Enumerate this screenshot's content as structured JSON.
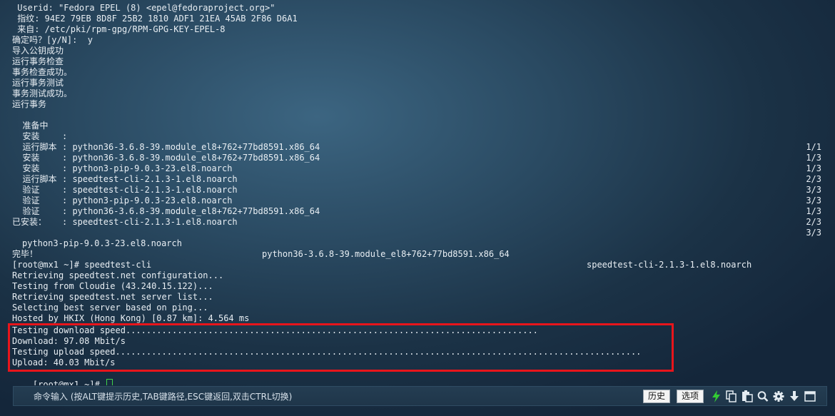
{
  "terminal": {
    "header_lines": [
      " Userid: \"Fedora EPEL (8) <epel@fedoraproject.org>\"",
      " 指纹: 94E2 79EB 8D8F 25B2 1810 ADF1 21EA 45AB 2F86 D6A1",
      " 来自: /etc/pki/rpm-gpg/RPM-GPG-KEY-EPEL-8",
      "确定吗？[y/N]:  y",
      "导入公钥成功",
      "运行事务检查",
      "事务检查成功。",
      "运行事务测试",
      "事务测试成功。",
      "运行事务"
    ],
    "transactions": [
      {
        "action": "  准备中  ",
        "package": ":",
        "progress": "1/1"
      },
      {
        "action": "  安装    ",
        "package": ": python36-3.6.8-39.module_el8+762+77bd8591.x86_64",
        "progress": "1/3"
      },
      {
        "action": "  运行脚本",
        "package": ": python36-3.6.8-39.module_el8+762+77bd8591.x86_64",
        "progress": "1/3"
      },
      {
        "action": "  安装    ",
        "package": ": python3-pip-9.0.3-23.el8.noarch",
        "progress": "2/3"
      },
      {
        "action": "  安装    ",
        "package": ": speedtest-cli-2.1.3-1.el8.noarch",
        "progress": "3/3"
      },
      {
        "action": "  运行脚本",
        "package": ": speedtest-cli-2.1.3-1.el8.noarch",
        "progress": "3/3"
      },
      {
        "action": "  验证    ",
        "package": ": python3-pip-9.0.3-23.el8.noarch",
        "progress": "1/3"
      },
      {
        "action": "  验证    ",
        "package": ": python36-3.6.8-39.module_el8+762+77bd8591.x86_64",
        "progress": "2/3"
      },
      {
        "action": "  验证    ",
        "package": ": speedtest-cli-2.1.3-1.el8.noarch",
        "progress": "3/3"
      }
    ],
    "installed_label": "已安装：",
    "installed_packages": [
      "python3-pip-9.0.3-23.el8.noarch",
      "python36-3.6.8-39.module_el8+762+77bd8591.x86_64",
      "speedtest-cli-2.1.3-1.el8.noarch"
    ],
    "done_label": "完毕！",
    "speedtest_lines": [
      "[root@mx1 ~]# speedtest-cli",
      "Retrieving speedtest.net configuration...",
      "Testing from Cloudie (43.240.15.122)...",
      "Retrieving speedtest.net server list...",
      "Selecting best server based on ping...",
      "Hosted by HKIX (Hong Kong) [0.87 km]: 4.564 ms"
    ],
    "result_lines": [
      "Testing download speed................................................................................",
      "Download: 97.08 Mbit/s",
      "Testing upload speed......................................................................................................",
      "Upload: 40.03 Mbit/s"
    ],
    "prompt": "[root@mx1 ~]# "
  },
  "cmdbar": {
    "placeholder": "命令输入 (按ALT键提示历史,TAB键路径,ESC键返回,双击CTRL切换)",
    "history_label": "历史",
    "options_label": "选项"
  },
  "icons": {
    "lightning": "lightning-icon",
    "copy": "copy-icon",
    "paste": "paste-icon",
    "search": "search-icon",
    "settings": "gear-icon",
    "download": "download-icon",
    "window": "window-icon"
  },
  "colors": {
    "highlight_border": "#e8151b",
    "cursor": "#3fd24a",
    "lightning": "#33cc33"
  }
}
